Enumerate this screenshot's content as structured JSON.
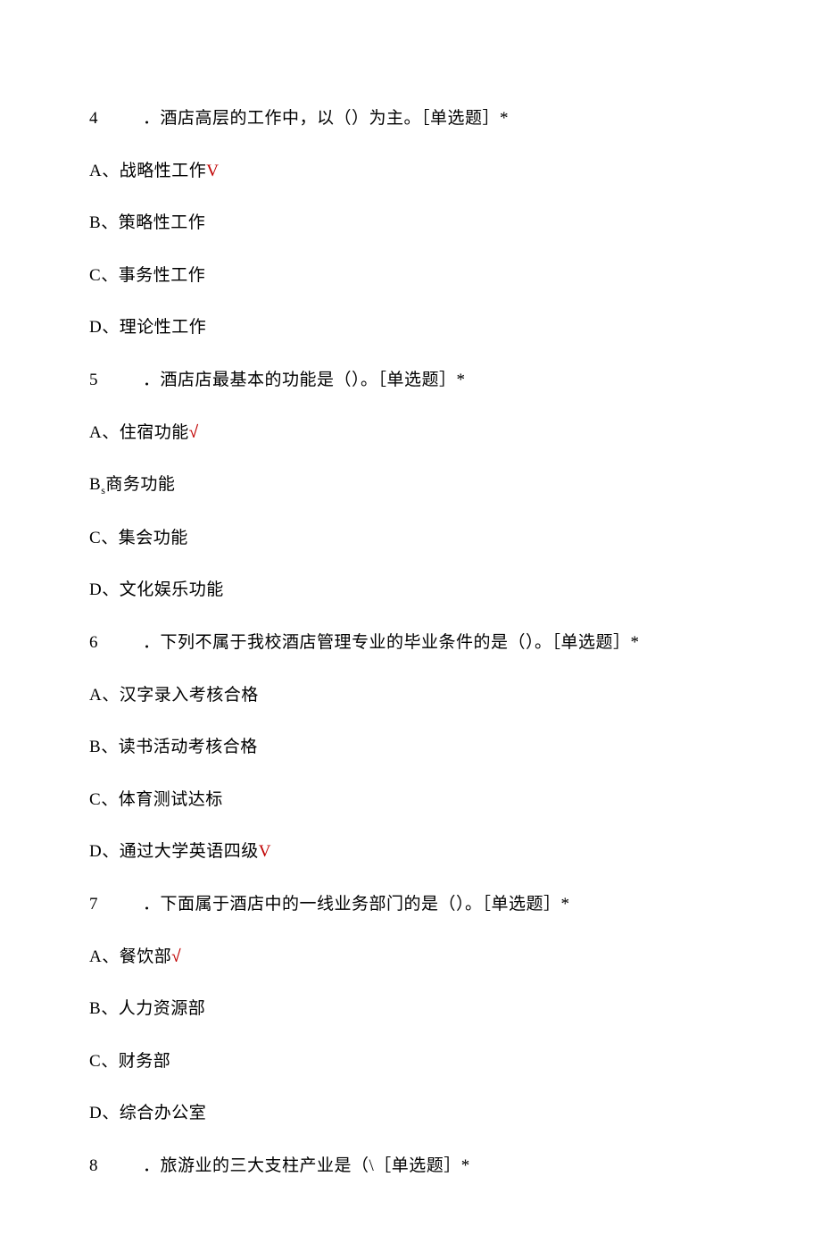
{
  "questions": [
    {
      "num": "4",
      "prefix": "．",
      "text": "酒店高层的工作中，以（）为主。［单选题］*",
      "options": [
        {
          "letter": "A",
          "sep": "、",
          "text": "战略性工作",
          "mark": "V",
          "markClass": "correct-v"
        },
        {
          "letter": "B",
          "sep": "、",
          "text": "策略性工作"
        },
        {
          "letter": "C",
          "sep": "、",
          "text": "事务性工作"
        },
        {
          "letter": "D",
          "sep": "、",
          "text": "理论性工作"
        }
      ]
    },
    {
      "num": "5",
      "prefix": "．",
      "text": "酒店店最基本的功能是（）。［单选题］*",
      "options": [
        {
          "letter": "A",
          "sep": "、",
          "text": "住宿功能",
          "mark": "√",
          "markClass": "correct-check"
        },
        {
          "letter": "B",
          "sep": "s",
          "sepClass": "small-s",
          "text": "商务功能"
        },
        {
          "letter": "C",
          "sep": "、",
          "text": "集会功能"
        },
        {
          "letter": "D",
          "sep": "、",
          "text": "文化娱乐功能"
        }
      ]
    },
    {
      "num": "6",
      "prefix": "．",
      "text": "下列不属于我校酒店管理专业的毕业条件的是（）。［单选题］*",
      "options": [
        {
          "letter": "A",
          "sep": "、",
          "text": "汉字录入考核合格"
        },
        {
          "letter": "B",
          "sep": "、",
          "text": "读书活动考核合格"
        },
        {
          "letter": "C",
          "sep": "、",
          "text": "体育测试达标"
        },
        {
          "letter": "D",
          "sep": "、",
          "text": "通过大学英语四级",
          "mark": "V",
          "markClass": "correct-v"
        }
      ]
    },
    {
      "num": "7",
      "prefix": "．",
      "text": "下面属于酒店中的一线业务部门的是（）。［单选题］*",
      "options": [
        {
          "letter": "A",
          "sep": "、",
          "text": "餐饮部",
          "mark": "√",
          "markClass": "correct-check"
        },
        {
          "letter": "B",
          "sep": "、",
          "text": "人力资源部"
        },
        {
          "letter": "C",
          "sep": "、",
          "text": "财务部"
        },
        {
          "letter": "D",
          "sep": "、",
          "text": "综合办公室"
        }
      ]
    },
    {
      "num": "8",
      "prefix": "．",
      "text": "旅游业的三大支柱产业是（\\［单选题］*",
      "options": []
    }
  ]
}
